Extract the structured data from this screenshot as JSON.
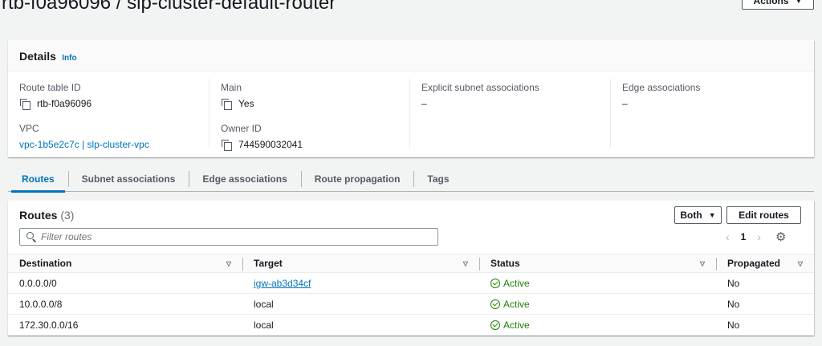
{
  "page": {
    "title": "rtb-f0a96096 / slp-cluster-default-router",
    "actions_label": "Actions"
  },
  "details": {
    "heading": "Details",
    "info": "Info",
    "route_table_id_label": "Route table ID",
    "route_table_id": "rtb-f0a96096",
    "main_label": "Main",
    "main_value": "Yes",
    "explicit_label": "Explicit subnet associations",
    "explicit_value": "–",
    "edge_label": "Edge associations",
    "edge_value": "–",
    "vpc_label": "VPC",
    "vpc_value": "vpc-1b5e2c7c | slp-cluster-vpc",
    "owner_label": "Owner ID",
    "owner_value": "744590032041"
  },
  "tabs": [
    {
      "label": "Routes",
      "active": true
    },
    {
      "label": "Subnet associations",
      "active": false
    },
    {
      "label": "Edge associations",
      "active": false
    },
    {
      "label": "Route propagation",
      "active": false
    },
    {
      "label": "Tags",
      "active": false
    }
  ],
  "routes": {
    "title": "Routes",
    "count": "(3)",
    "filter_select": "Both",
    "edit_label": "Edit routes",
    "filter_placeholder": "Filter routes",
    "page_number": "1",
    "columns": [
      "Destination",
      "Target",
      "Status",
      "Propagated"
    ],
    "rows": [
      {
        "destination": "0.0.0.0/0",
        "target": "igw-ab3d34cf",
        "target_link": true,
        "status": "Active",
        "propagated": "No"
      },
      {
        "destination": "10.0.0.0/8",
        "target": "local",
        "target_link": false,
        "status": "Active",
        "propagated": "No"
      },
      {
        "destination": "172.30.0.0/16",
        "target": "local",
        "target_link": false,
        "status": "Active",
        "propagated": "No"
      }
    ]
  },
  "colors": {
    "link": "#0073bb",
    "success": "#1d8102",
    "background": "#f2f3f3"
  }
}
